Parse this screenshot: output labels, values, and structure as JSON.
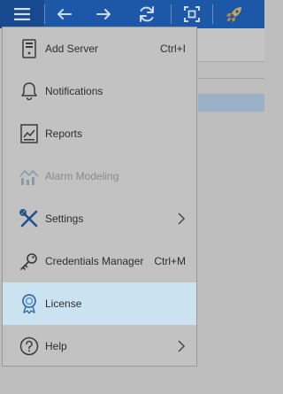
{
  "toolbar": {
    "buttons": [
      {
        "name": "hamburger-menu-icon"
      },
      {
        "name": "back-arrow-icon"
      },
      {
        "name": "forward-arrow-icon"
      },
      {
        "name": "refresh-icon"
      },
      {
        "name": "fit-screen-icon"
      },
      {
        "name": "rocket-icon"
      }
    ]
  },
  "menu": {
    "items": [
      {
        "label": "Add Server",
        "shortcut": "Ctrl+I",
        "icon": "server-icon",
        "enabled": true
      },
      {
        "label": "Notifications",
        "shortcut": "",
        "icon": "bell-icon",
        "enabled": true
      },
      {
        "label": "Reports",
        "shortcut": "",
        "icon": "report-icon",
        "enabled": true
      },
      {
        "label": "Alarm Modeling",
        "shortcut": "",
        "icon": "alarm-modeling-icon",
        "enabled": false
      },
      {
        "label": "Settings",
        "shortcut": "",
        "icon": "wrench-screwdriver-icon",
        "enabled": true,
        "submenu": true
      },
      {
        "label": "Credentials Manager",
        "shortcut": "Ctrl+M",
        "icon": "key-icon",
        "enabled": true
      },
      {
        "label": "License",
        "shortcut": "",
        "icon": "license-award-icon",
        "enabled": true,
        "highlighted": true
      },
      {
        "label": "Help",
        "shortcut": "",
        "icon": "help-icon",
        "enabled": true,
        "submenu": true
      }
    ]
  },
  "colors": {
    "toolbar_bg": "#1d58a8",
    "menu_bg": "#c2c2c2",
    "highlight_bg": "#cbe3f1",
    "disabled_text": "#8a8a8a"
  }
}
